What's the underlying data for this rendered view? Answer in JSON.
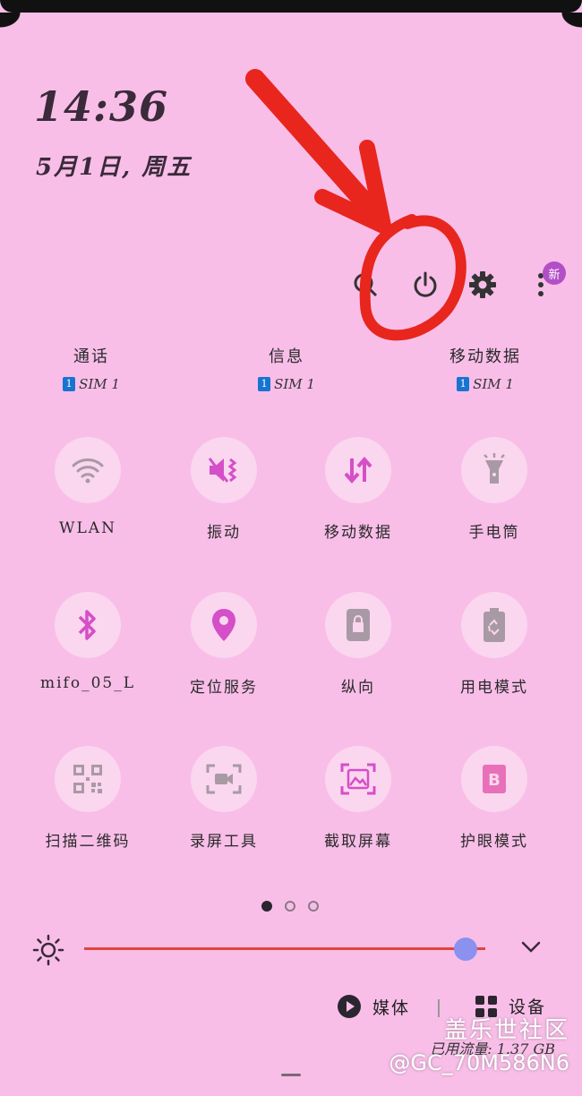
{
  "status": {
    "time": "14:36",
    "date": "5月1日, 周五"
  },
  "top_actions": {
    "new_badge": "新"
  },
  "sim_columns": [
    {
      "name": "通话",
      "sim": "SIM 1",
      "chip": "1"
    },
    {
      "name": "信息",
      "sim": "SIM 1",
      "chip": "1"
    },
    {
      "name": "移动数据",
      "sim": "SIM 1",
      "chip": "1"
    }
  ],
  "tiles": [
    {
      "label": "WLAN",
      "icon": "wifi-icon"
    },
    {
      "label": "振动",
      "icon": "vibrate-icon"
    },
    {
      "label": "移动数据",
      "icon": "mobile-data-icon"
    },
    {
      "label": "手电筒",
      "icon": "flashlight-icon"
    },
    {
      "label": "mifo_05_L",
      "icon": "bluetooth-icon"
    },
    {
      "label": "定位服务",
      "icon": "location-icon"
    },
    {
      "label": "纵向",
      "icon": "portrait-lock-icon"
    },
    {
      "label": "用电模式",
      "icon": "power-mode-icon"
    },
    {
      "label": "扫描二维码",
      "icon": "qr-code-icon"
    },
    {
      "label": "录屏工具",
      "icon": "screen-record-icon"
    },
    {
      "label": "截取屏幕",
      "icon": "screenshot-icon"
    },
    {
      "label": "护眼模式",
      "icon": "eye-comfort-icon"
    }
  ],
  "pagination": {
    "total": 3,
    "current": 1
  },
  "brightness": {
    "level": 0.95
  },
  "bottom": {
    "media_label": "媒体",
    "devices_label": "设备",
    "data_usage": "已用流量: 1.37 GB"
  },
  "watermark": {
    "line1": "盖乐世社区",
    "line2": "@GC_70M586N6"
  },
  "colors": {
    "background": "#f8bee8",
    "accent": "#d44fc8",
    "slider": "#e0453a",
    "thumb": "#8a91ef",
    "annotation": "#e8261e"
  }
}
